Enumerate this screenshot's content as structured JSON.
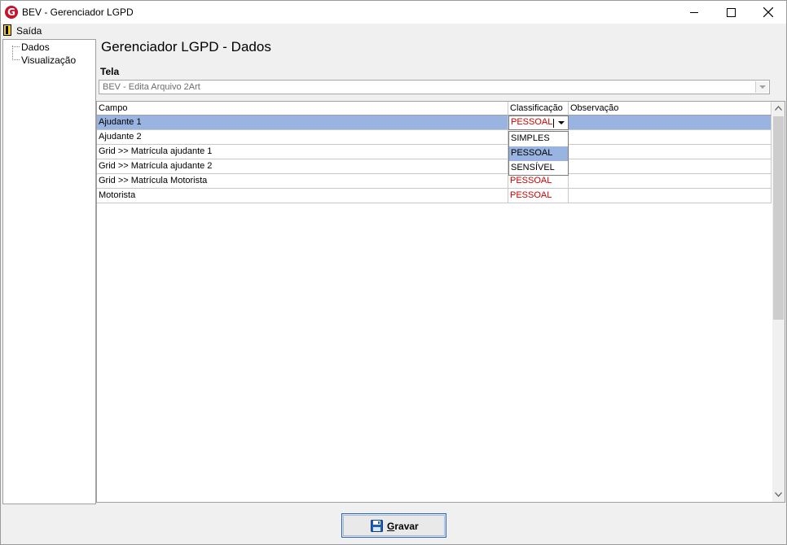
{
  "window": {
    "title": "BEV - Gerenciador LGPD"
  },
  "menu": {
    "exit_label": "Saída"
  },
  "tree": {
    "items": [
      {
        "label": "Dados"
      },
      {
        "label": "Visualização"
      }
    ]
  },
  "main": {
    "title": "Gerenciador LGPD - Dados",
    "tela_label": "Tela",
    "tela_value": "BEV - Edita Arquivo 2Art"
  },
  "grid": {
    "columns": [
      "Campo",
      "Classificação",
      "Observação"
    ],
    "rows": [
      {
        "campo": "Ajudante 1",
        "classificacao": "PESSOAL",
        "observacao": ""
      },
      {
        "campo": "Ajudante 2",
        "classificacao": "",
        "observacao": ""
      },
      {
        "campo": "Grid >> Matrícula ajudante 1",
        "classificacao": "",
        "observacao": ""
      },
      {
        "campo": "Grid >> Matrícula ajudante 2",
        "classificacao": "",
        "observacao": ""
      },
      {
        "campo": "Grid >> Matrícula Motorista",
        "classificacao": "PESSOAL",
        "observacao": ""
      },
      {
        "campo": "Motorista",
        "classificacao": "PESSOAL",
        "observacao": ""
      }
    ],
    "dropdown_options": [
      "SIMPLES",
      "PESSOAL",
      "SENSÍVEL"
    ],
    "dropdown_highlighted": "PESSOAL"
  },
  "actions": {
    "save_label_underlined": "G",
    "save_label_rest": "ravar"
  },
  "colors": {
    "selection": "#99b4e0",
    "classification_text": "#d00000",
    "app_icon": "#c4122f"
  }
}
